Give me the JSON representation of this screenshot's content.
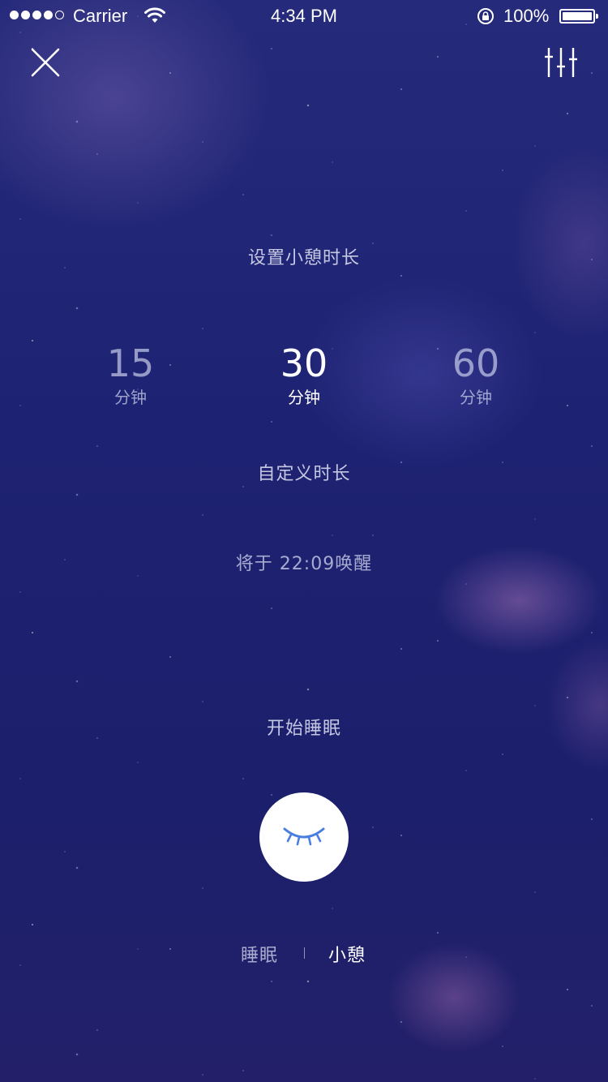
{
  "status_bar": {
    "carrier": "Carrier",
    "time": "4:34 PM",
    "battery_percent": "100%",
    "battery_level": 1.0,
    "signal_bars_filled": 4,
    "signal_bars_total": 5,
    "icons": [
      "signal-dots-icon",
      "wifi-icon",
      "rotation-lock-icon",
      "battery-icon"
    ]
  },
  "toolbar": {
    "close_icon": "close-icon",
    "settings_icon": "sliders-icon"
  },
  "nap": {
    "title": "设置小憩时长",
    "durations": [
      {
        "value": "15",
        "unit": "分钟",
        "active": false
      },
      {
        "value": "30",
        "unit": "分钟",
        "active": true
      },
      {
        "value": "60",
        "unit": "分钟",
        "active": false
      }
    ],
    "custom_label": "自定义时长",
    "wake_text": "将于 22:09唤醒"
  },
  "start": {
    "label": "开始睡眠",
    "button_icon": "closed-eye-icon"
  },
  "modes": {
    "sleep_label": "睡眠",
    "nap_label": "小憩",
    "active": "nap"
  },
  "colors": {
    "background": "#1e2272",
    "accent_icon": "#4a7fe0",
    "button_bg": "#ffffff"
  }
}
